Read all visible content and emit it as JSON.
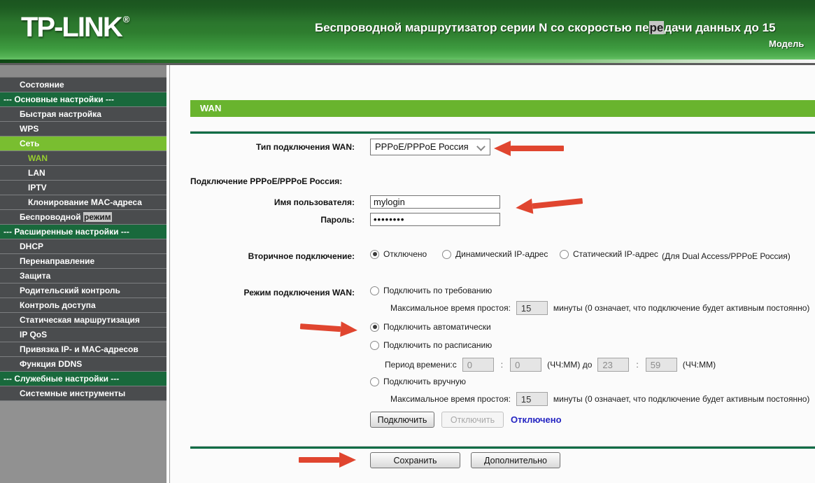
{
  "header": {
    "logo": "TP-LINK",
    "logo_reg": "®",
    "title_pre": "Беспроводной маршрутизатор серии N со скоростью пе",
    "title_highlight": "ре",
    "title_post": "дачи данных до 15",
    "subtitle": "Модель"
  },
  "sidebar": {
    "items": [
      {
        "label": "Состояние"
      },
      {
        "label": "--- Основные настройки ---"
      },
      {
        "label": "Быстрая настройка"
      },
      {
        "label": "WPS"
      },
      {
        "label": "Сеть"
      },
      {
        "label": "WAN"
      },
      {
        "label": "LAN"
      },
      {
        "label": "IPTV"
      },
      {
        "label": "Клонирование MAC-адреса"
      },
      {
        "label": "Беспроводной ",
        "highlight": "режим"
      },
      {
        "label": "--- Расширенные настройки ---"
      },
      {
        "label": "DHCP"
      },
      {
        "label": "Перенаправление"
      },
      {
        "label": "Защита"
      },
      {
        "label": "Родительский контроль"
      },
      {
        "label": "Контроль доступа"
      },
      {
        "label": "Статическая маршрутизация"
      },
      {
        "label": "IP QoS"
      },
      {
        "label": "Привязка IP- и MAC-адресов"
      },
      {
        "label": "Функция DDNS"
      },
      {
        "label": "--- Служебные настройки ---"
      },
      {
        "label": "Системные инструменты"
      }
    ]
  },
  "main": {
    "page_title": "WAN",
    "wan_type": {
      "label": "Тип подключения WAN:",
      "value": "PPPoE/PPPoE Россия"
    },
    "pppoe_section_label": "Подключение PPPoE/PPPoE Россия:",
    "username": {
      "label": "Имя пользователя:",
      "value": "mylogin"
    },
    "password": {
      "label": "Пароль:",
      "value": "••••••••"
    },
    "secondary": {
      "label": "Вторичное подключение:",
      "option_disabled": "Отключено",
      "option_dynamic": "Динамический IP-адрес",
      "option_static": "Статический IP-адрес",
      "selected": "Отключено",
      "note": "(Для Dual Access/PPPoE Россия)"
    },
    "wan_mode": {
      "label": "Режим подключения WAN:",
      "option_demand": "Подключить по требованию",
      "option_auto": "Подключить автоматически",
      "option_schedule": "Подключить по расписанию",
      "option_manual": "Подключить вручную",
      "selected": "Подключить автоматически",
      "idle_label": "Максимальное время простоя:",
      "idle_value": "15",
      "idle_note": "минуты (0 означает, что подключение будет активным постоянно)",
      "period_label": "Период времени:с",
      "period_colon": ":",
      "period_from_h": "0",
      "period_from_m": "0",
      "period_mid": "(ЧЧ:ММ) до",
      "period_to_h": "23",
      "period_to_m": "59",
      "period_note": "(ЧЧ:ММ)"
    },
    "connect_button": "Подключить",
    "disconnect_button": "Отключить",
    "status_text": "Отключено",
    "save_button": "Сохранить",
    "advanced_button": "Дополнительно"
  },
  "colors": {
    "header_green": "#2E7D2F",
    "menu_selected_green": "#79BE30",
    "menu_section_green": "#19693C",
    "wan_bar_green": "#69B42E",
    "divider_green": "#0B6C45",
    "annotation_arrow_red": "#E0452F",
    "status_blue": "#2424C2",
    "active_item_text": "#97CE2F"
  }
}
